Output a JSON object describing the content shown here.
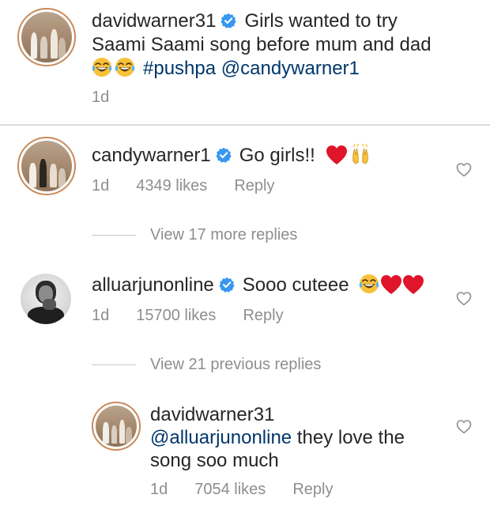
{
  "post": {
    "username": "davidwarner31",
    "caption_text": "Girls wanted to try",
    "caption_line2": "Saami Saami song before mum and dad",
    "hashtag": "#pushpa",
    "mention": "@candywarner1",
    "time": "1d"
  },
  "comments": [
    {
      "username": "candywarner1",
      "text": "Go girls!!",
      "time": "1d",
      "likes": "4349 likes",
      "reply_label": "Reply",
      "view_replies": "View 17 more replies"
    },
    {
      "username": "alluarjunonline",
      "text": "Sooo cuteee",
      "time": "1d",
      "likes": "15700 likes",
      "reply_label": "Reply",
      "view_replies": "View 21 previous replies"
    }
  ],
  "reply": {
    "username": "davidwarner31",
    "mention": "@alluarjunonline",
    "text_line1": "they love the",
    "text_line2": "song soo much",
    "time": "1d",
    "likes": "7054 likes",
    "reply_label": "Reply"
  },
  "icons": {
    "verified": "verified-badge-icon",
    "like": "heart-outline-icon",
    "laughing": "laughing-emoji-icon",
    "red_heart": "red-heart-emoji-icon",
    "raised_hands": "raised-hands-emoji-icon"
  },
  "colors": {
    "verified": "#3897f0",
    "link": "#00376b",
    "secondary_text": "#8e8e8e",
    "red_heart": "#e0142b"
  }
}
